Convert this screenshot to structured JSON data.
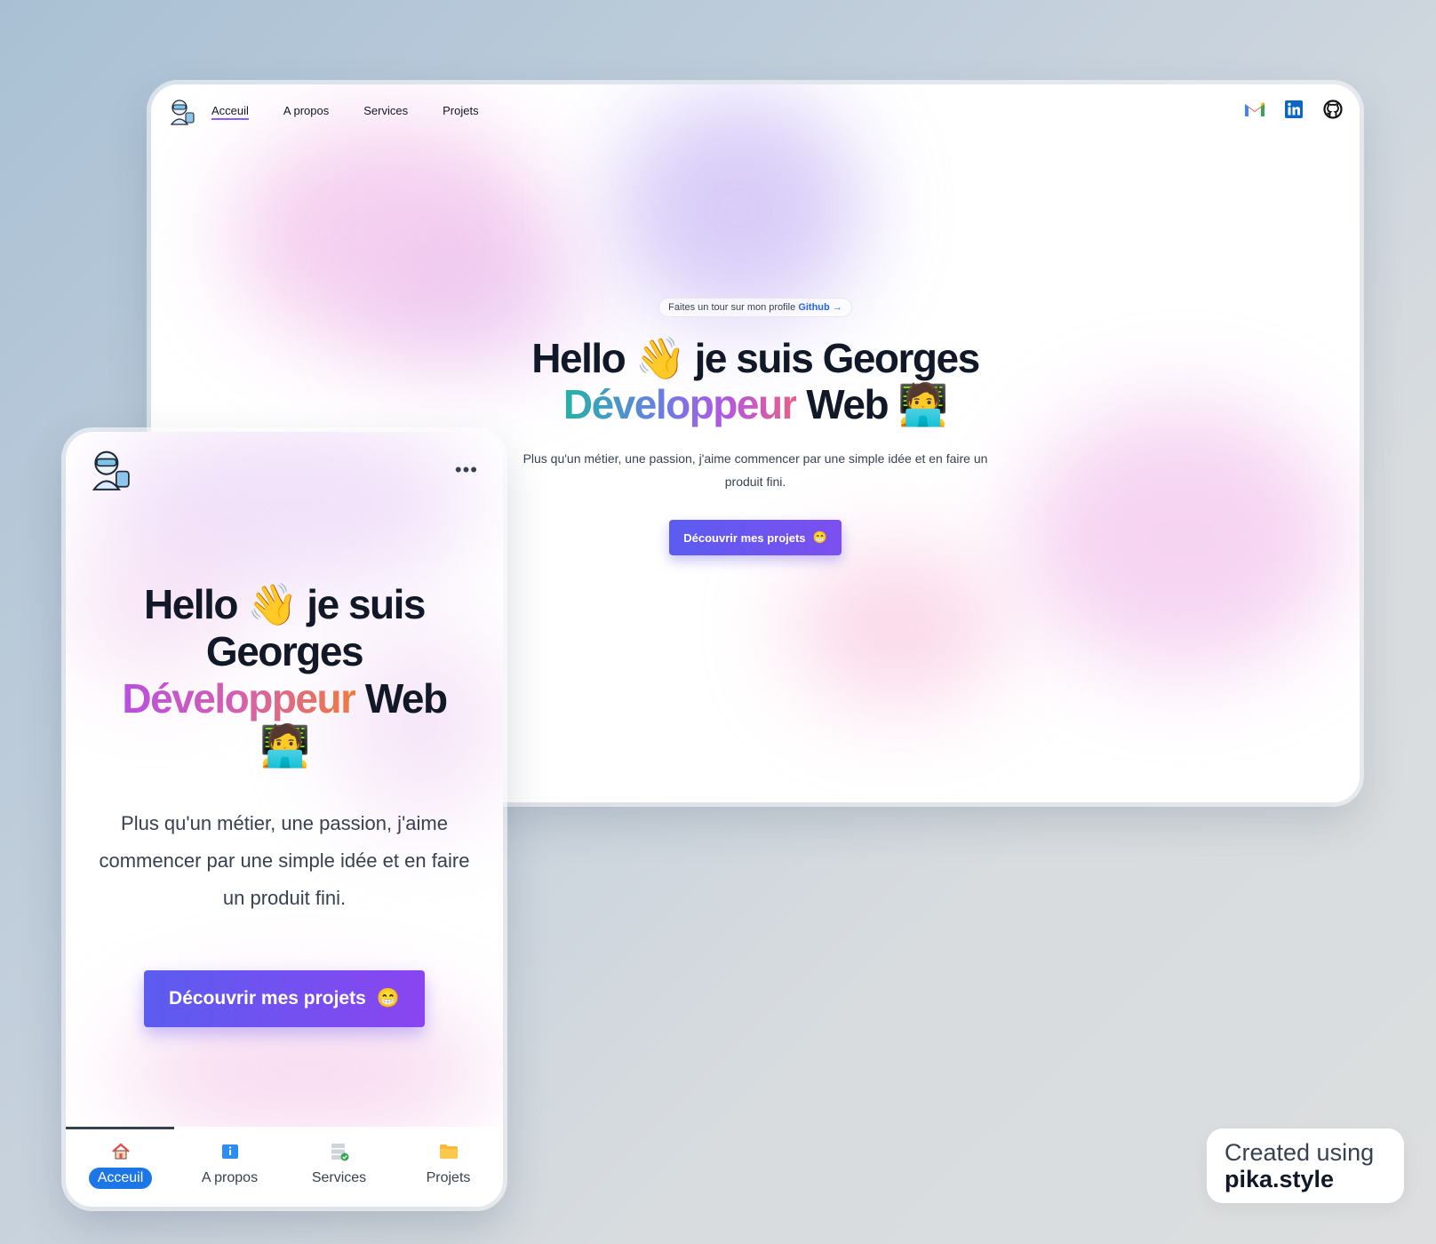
{
  "desktop": {
    "nav": {
      "links": [
        "Acceuil",
        "A propos",
        "Services",
        "Projets"
      ],
      "active": "Acceuil",
      "social_icons": [
        "gmail-icon",
        "linkedin-icon",
        "github-icon"
      ]
    },
    "hero": {
      "pill_text": "Faites un tour sur mon profile",
      "pill_link": "Github →",
      "title_line1_a": "Hello",
      "wave_emoji": "👋",
      "title_line1_b": "je suis Georges",
      "title_gradient": "Développeur",
      "title_web": "Web",
      "developer_emoji": "🧑‍💻",
      "subtitle": "Plus qu'un métier, une passion, j'aime commencer par une simple idée et en faire un produit fini.",
      "cta_label": "Découvrir mes projets",
      "cta_emoji": "😁"
    }
  },
  "mobile": {
    "menu_icon": "more-dots-icon",
    "hero": {
      "title_line1_a": "Hello",
      "wave_emoji": "👋",
      "title_line1_b": "je suis",
      "title_line2": "Georges",
      "title_gradient": "Développeur",
      "title_web": "Web",
      "developer_emoji": "🧑‍💻",
      "subtitle": "Plus qu'un métier, une passion, j'aime commencer par une simple idée et en faire un produit fini.",
      "cta_label": "Découvrir mes projets",
      "cta_emoji": "😁"
    },
    "tabbar": {
      "tabs": [
        {
          "label": "Acceuil",
          "icon": "home-icon"
        },
        {
          "label": "A propos",
          "icon": "info-icon"
        },
        {
          "label": "Services",
          "icon": "server-check-icon"
        },
        {
          "label": "Projets",
          "icon": "folder-icon"
        }
      ],
      "active": "Acceuil"
    }
  },
  "credit": {
    "line1": "Created using",
    "line2": "pika.style"
  },
  "colors": {
    "accent_purple": "#7c4ff0",
    "link_blue": "#2563eb",
    "active_tab": "#1d76e6"
  }
}
